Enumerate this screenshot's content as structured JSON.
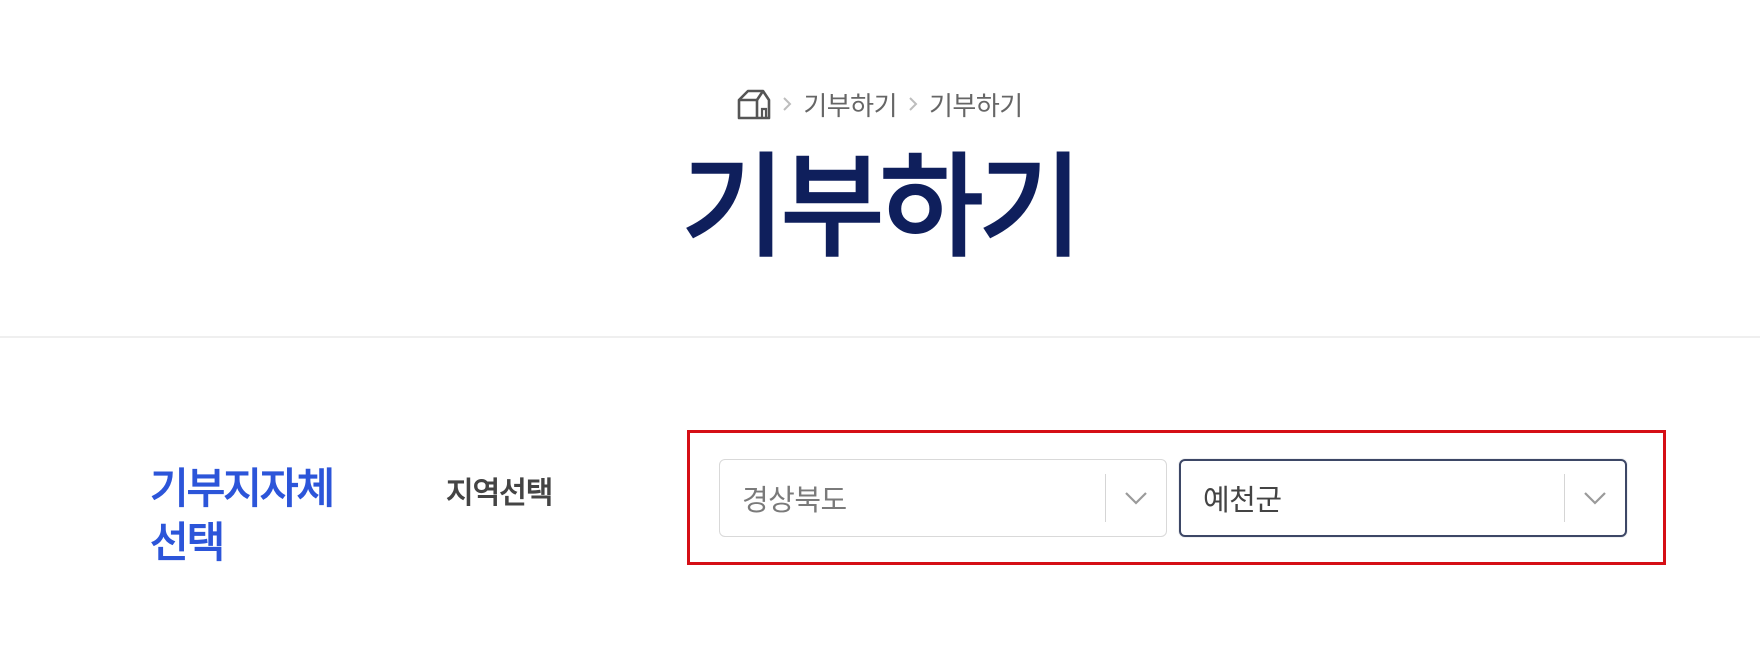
{
  "breadcrumb": {
    "items": [
      "기부하기",
      "기부하기"
    ]
  },
  "page": {
    "title": "기부하기"
  },
  "section": {
    "label": "기부지자체 선택",
    "field_label": "지역선택"
  },
  "region": {
    "province": {
      "value": "경상북도"
    },
    "district": {
      "value": "예천군"
    }
  },
  "colors": {
    "title": "#0f1f5c",
    "accent": "#2c55d9",
    "highlight": "#d50f16"
  }
}
